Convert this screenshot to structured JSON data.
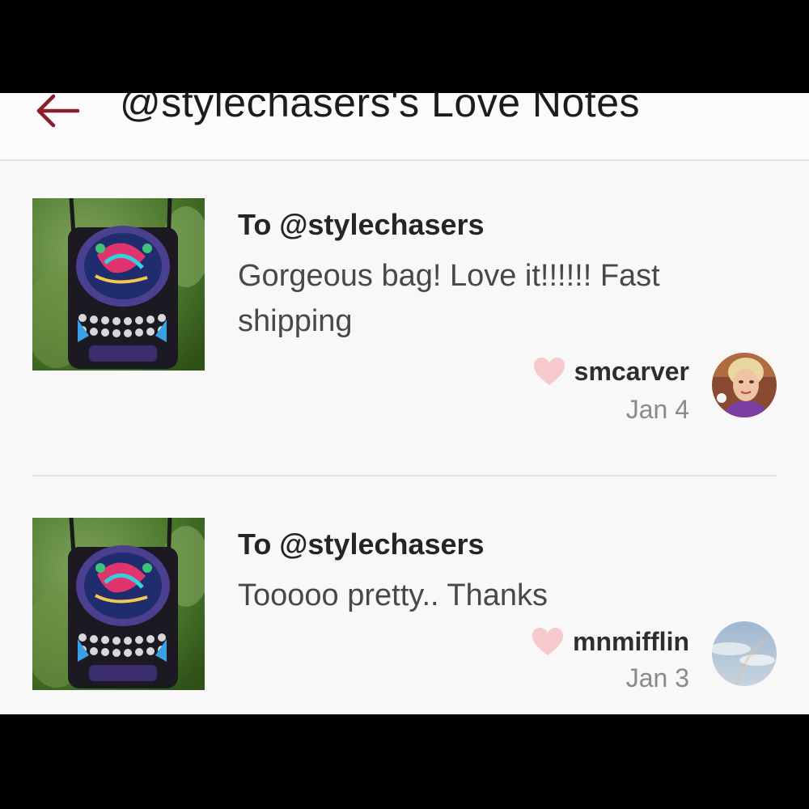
{
  "header": {
    "title": "@stylechasers's Love Notes",
    "back_icon": "arrow-left-icon",
    "accent_color": "#8a1f2b"
  },
  "notes": [
    {
      "recipient": "To @stylechasers",
      "message": "Gorgeous bag! Love it!!!!!! Fast shipping",
      "author": "smcarver",
      "date": "Jan 4",
      "heart_icon": "heart-icon",
      "heart_color": "#f6c9cc"
    },
    {
      "recipient": "To @stylechasers",
      "message": "Tooooo pretty.. Thanks",
      "author": "mnmifflin",
      "date": "Jan 3",
      "heart_icon": "heart-icon",
      "heart_color": "#f6c9cc"
    }
  ]
}
